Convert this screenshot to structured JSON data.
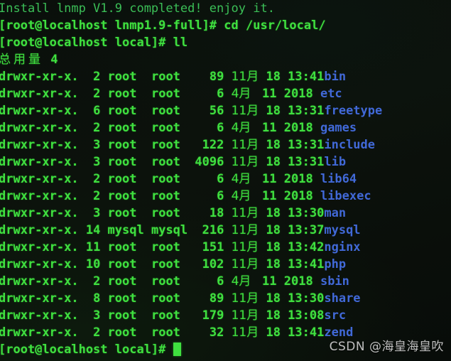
{
  "terminal": {
    "colors": {
      "background": "#0a0f0b",
      "text_green": "#3fe03f",
      "text_green_dim": "#3bbf57",
      "directory_blue": "#4169d8",
      "cursor": "#3fe03f",
      "watermark": "#e8e8e8"
    },
    "banner": "Install lnmp V1.9 completed! enjoy it.",
    "prompt_1": {
      "text": "[root@localhost lnmp1.9-full]# ",
      "command": "cd /usr/local/"
    },
    "prompt_2": {
      "text": "[root@localhost local]# ",
      "command": "ll"
    },
    "total_label": "总用量",
    "total_value": "4",
    "listing": [
      {
        "perms": "drwxr-xr-x.",
        "links": "2",
        "owner": "root",
        "group": "root",
        "size": "89",
        "month": "11月",
        "day": "18",
        "time": "13:41",
        "name": "bin"
      },
      {
        "perms": "drwxr-xr-x.",
        "links": "2",
        "owner": "root",
        "group": "root",
        "size": "6",
        "month": "4月",
        "day": "11",
        "time": "2018",
        "name": "etc"
      },
      {
        "perms": "drwxr-xr-x.",
        "links": "6",
        "owner": "root",
        "group": "root",
        "size": "56",
        "month": "11月",
        "day": "18",
        "time": "13:31",
        "name": "freetype"
      },
      {
        "perms": "drwxr-xr-x.",
        "links": "2",
        "owner": "root",
        "group": "root",
        "size": "6",
        "month": "4月",
        "day": "11",
        "time": "2018",
        "name": "games"
      },
      {
        "perms": "drwxr-xr-x.",
        "links": "3",
        "owner": "root",
        "group": "root",
        "size": "122",
        "month": "11月",
        "day": "18",
        "time": "13:31",
        "name": "include"
      },
      {
        "perms": "drwxr-xr-x.",
        "links": "3",
        "owner": "root",
        "group": "root",
        "size": "4096",
        "month": "11月",
        "day": "18",
        "time": "13:31",
        "name": "lib"
      },
      {
        "perms": "drwxr-xr-x.",
        "links": "2",
        "owner": "root",
        "group": "root",
        "size": "6",
        "month": "4月",
        "day": "11",
        "time": "2018",
        "name": "lib64"
      },
      {
        "perms": "drwxr-xr-x.",
        "links": "2",
        "owner": "root",
        "group": "root",
        "size": "6",
        "month": "4月",
        "day": "11",
        "time": "2018",
        "name": "libexec"
      },
      {
        "perms": "drwxr-xr-x.",
        "links": "3",
        "owner": "root",
        "group": "root",
        "size": "18",
        "month": "11月",
        "day": "18",
        "time": "13:30",
        "name": "man"
      },
      {
        "perms": "drwxr-xr-x.",
        "links": "14",
        "owner": "mysql",
        "group": "mysql",
        "size": "216",
        "month": "11月",
        "day": "18",
        "time": "13:37",
        "name": "mysql"
      },
      {
        "perms": "drwxr-xr-x.",
        "links": "11",
        "owner": "root",
        "group": "root",
        "size": "151",
        "month": "11月",
        "day": "18",
        "time": "13:42",
        "name": "nginx"
      },
      {
        "perms": "drwxr-xr-x.",
        "links": "10",
        "owner": "root",
        "group": "root",
        "size": "102",
        "month": "11月",
        "day": "18",
        "time": "13:41",
        "name": "php"
      },
      {
        "perms": "drwxr-xr-x.",
        "links": "2",
        "owner": "root",
        "group": "root",
        "size": "6",
        "month": "4月",
        "day": "11",
        "time": "2018",
        "name": "sbin"
      },
      {
        "perms": "drwxr-xr-x.",
        "links": "8",
        "owner": "root",
        "group": "root",
        "size": "89",
        "month": "11月",
        "day": "18",
        "time": "13:30",
        "name": "share"
      },
      {
        "perms": "drwxr-xr-x.",
        "links": "3",
        "owner": "root",
        "group": "root",
        "size": "179",
        "month": "11月",
        "day": "18",
        "time": "13:08",
        "name": "src"
      },
      {
        "perms": "drwxr-xr-x.",
        "links": "2",
        "owner": "root",
        "group": "root",
        "size": "32",
        "month": "11月",
        "day": "18",
        "time": "13:41",
        "name": "zend"
      }
    ],
    "final_prompt": "[root@localhost local]# "
  },
  "watermark": "CSDN @海皇海皇吹"
}
